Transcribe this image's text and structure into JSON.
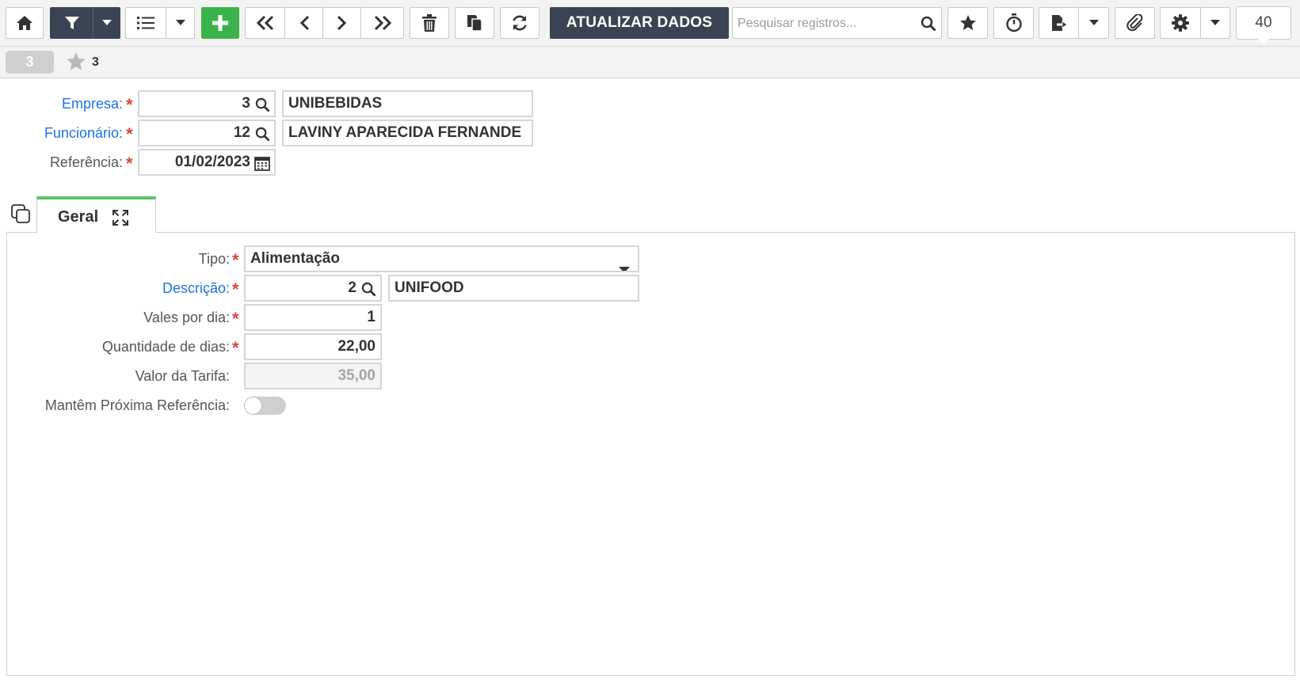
{
  "toolbar": {
    "refresh_data_label": "ATUALIZAR DADOS",
    "search_placeholder": "Pesquisar registros...",
    "page_size": "40",
    "icons": [
      "home-icon",
      "filter-icon",
      "caret-down-icon",
      "list-icon",
      "plus-icon",
      "first-icon",
      "prev-icon",
      "next-icon",
      "last-icon",
      "trash-icon",
      "copy-icon",
      "refresh-icon",
      "search-icon",
      "star-icon",
      "timer-icon",
      "export-icon",
      "paperclip-icon",
      "gear-icon"
    ]
  },
  "record_bar": {
    "record_number": "3",
    "favorites_count": "3"
  },
  "header_form": {
    "empresa": {
      "label": "Empresa:",
      "code": "3",
      "name": "UNIBEBIDAS"
    },
    "funcionario": {
      "label": "Funcionário:",
      "code": "12",
      "name": "LAVINY APARECIDA FERNANDE"
    },
    "referencia": {
      "label": "Referência:",
      "value": "01/02/2023"
    }
  },
  "tabs": [
    {
      "label": "Geral",
      "active": true
    }
  ],
  "geral_form": {
    "tipo": {
      "label": "Tipo:",
      "value": "Alimentação"
    },
    "descricao": {
      "label": "Descrição:",
      "code": "2",
      "name": "UNIFOOD"
    },
    "vales_por_dia": {
      "label": "Vales por dia:",
      "value": "1"
    },
    "quantidade_dias": {
      "label": "Quantidade de dias:",
      "value": "22,00"
    },
    "valor_tarifa": {
      "label": "Valor da Tarifa:",
      "value": "35,00"
    },
    "mantem_referencia": {
      "label": "Mantêm Próxima Referência:",
      "on": false
    }
  },
  "colors": {
    "accent_dark": "#3b4452",
    "accent_green": "#3bb34a",
    "link_blue": "#1a73e8",
    "required_red": "#d9453b",
    "tab_green": "#5cc26b"
  }
}
